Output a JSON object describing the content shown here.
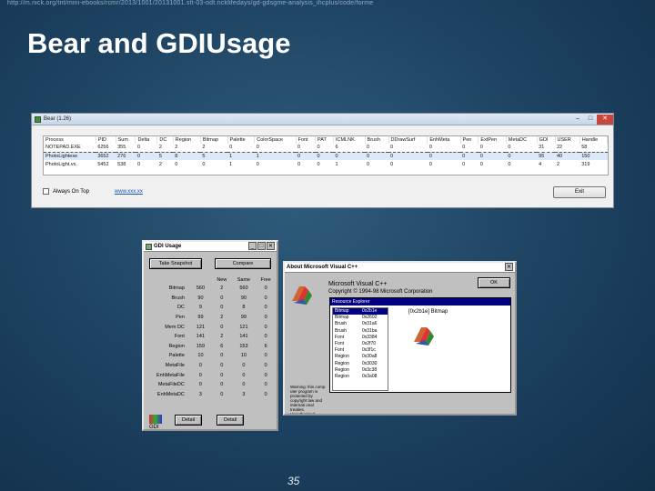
{
  "page": {
    "url_text": "http://m.nick.org/tnt/mini-ebooks/rcmr/2013/1001/20131001.stt-03-odt.ricklifedays/gd-gdsgme-analysis_ihcplus/code/forme",
    "title": "Bear and GDIUsage",
    "page_number": "35"
  },
  "bear": {
    "title": "Bear (1.26)",
    "columns": [
      "Process",
      "PID",
      "Sum",
      "Delta",
      "DC",
      "Region",
      "Bitmap",
      "Palette",
      "ColorSpace",
      "Font",
      "PAT",
      "ICMLNK",
      "Brush",
      "DDrawSurf",
      "EnhMeta",
      "Pen",
      "ExtPen",
      "MetaDC",
      "GDI",
      "USER",
      "Handle"
    ],
    "rows": [
      {
        "cells": [
          "NOTEPAD.EXE",
          "6256",
          "355",
          "0",
          "2",
          "2",
          "2",
          "0",
          "0",
          "0",
          "0",
          "6",
          "0",
          "0",
          "0",
          "0",
          "0",
          "0",
          "31",
          "22",
          "58"
        ],
        "selected": false
      },
      {
        "cells": [
          "PhotoLightexe",
          "3652",
          "276",
          "0",
          "5",
          "8",
          "5",
          "1",
          "1",
          "0",
          "0",
          "0",
          "0",
          "0",
          "0",
          "0",
          "0",
          "0",
          "95",
          "40",
          "150"
        ],
        "selected": true
      },
      {
        "cells": [
          "PhotoLight.vs.",
          "5452",
          "538",
          "0",
          "2",
          "0",
          "0",
          "1",
          "0",
          "0",
          "0",
          "1",
          "0",
          "0",
          "0",
          "0",
          "0",
          "0",
          "4",
          "2",
          "319"
        ],
        "selected": false
      }
    ],
    "always_on_top": "Always On Top",
    "link": "www.xxx.xx",
    "exit_label": "Exit"
  },
  "gdi": {
    "title": "GDI Usage",
    "take_snapshot": "Take Snapshot",
    "compare": "Compare",
    "headers": [
      "New",
      "Same",
      "Free"
    ],
    "rows": [
      {
        "label": "Bitmap",
        "values": [
          "560",
          "2",
          "560",
          "0"
        ]
      },
      {
        "label": "Brush",
        "values": [
          "90",
          "0",
          "90",
          "0"
        ]
      },
      {
        "label": "DC",
        "values": [
          "9",
          "0",
          "8",
          "0"
        ]
      },
      {
        "label": "Pen",
        "values": [
          "99",
          "2",
          "99",
          "0"
        ]
      },
      {
        "label": "Mem DC",
        "values": [
          "121",
          "0",
          "121",
          "0"
        ]
      },
      {
        "label": "Font",
        "values": [
          "141",
          "2",
          "141",
          "0"
        ]
      },
      {
        "label": "Region",
        "values": [
          "159",
          "6",
          "153",
          "6"
        ]
      },
      {
        "label": "Palette",
        "values": [
          "10",
          "0",
          "10",
          "0"
        ]
      },
      {
        "label": "MetaFile",
        "values": [
          "0",
          "0",
          "0",
          "0"
        ]
      },
      {
        "label": "EnhMetaFile",
        "values": [
          "0",
          "0",
          "0",
          "0"
        ]
      },
      {
        "label": "MetaFileDC",
        "values": [
          "0",
          "0",
          "0",
          "0"
        ]
      },
      {
        "label": "EnhMetaDC",
        "values": [
          "3",
          "0",
          "3",
          "0"
        ]
      }
    ],
    "logo_text": "GDI",
    "detail1": "Detail",
    "detail2": "Detail"
  },
  "about": {
    "title": "About Microsoft Visual C++",
    "product": "Microsoft Visual C++",
    "copyright": "Copyright © 1994-98 Microsoft Corporation",
    "ok": "OK",
    "panel_header": "Resource Explorer",
    "caption": "[0x2b1e] Bitmap",
    "resources": [
      {
        "type": "Bitmap",
        "handle": "0x2b1e",
        "selected": true
      },
      {
        "type": "Bitmap",
        "handle": "0x2602"
      },
      {
        "type": "Brush",
        "handle": "0x31a6"
      },
      {
        "type": "Brush",
        "handle": "0x31ba"
      },
      {
        "type": "Font",
        "handle": "0x3384"
      },
      {
        "type": "Font",
        "handle": "0x2f70"
      },
      {
        "type": "Font",
        "handle": "0x3f1c"
      },
      {
        "type": "Region",
        "handle": "0x30a8"
      },
      {
        "type": "Region",
        "handle": "0x3030"
      },
      {
        "type": "Region",
        "handle": "0x3c38"
      },
      {
        "type": "Region",
        "handle": "0x3a08"
      }
    ],
    "warning": "Warning: this comp uter program is protected by copyright law and internati onal treaties. Unauthorized reproduc tion or distribution of this program, or any portion of it, may result in severe civil and criminal penalties."
  }
}
